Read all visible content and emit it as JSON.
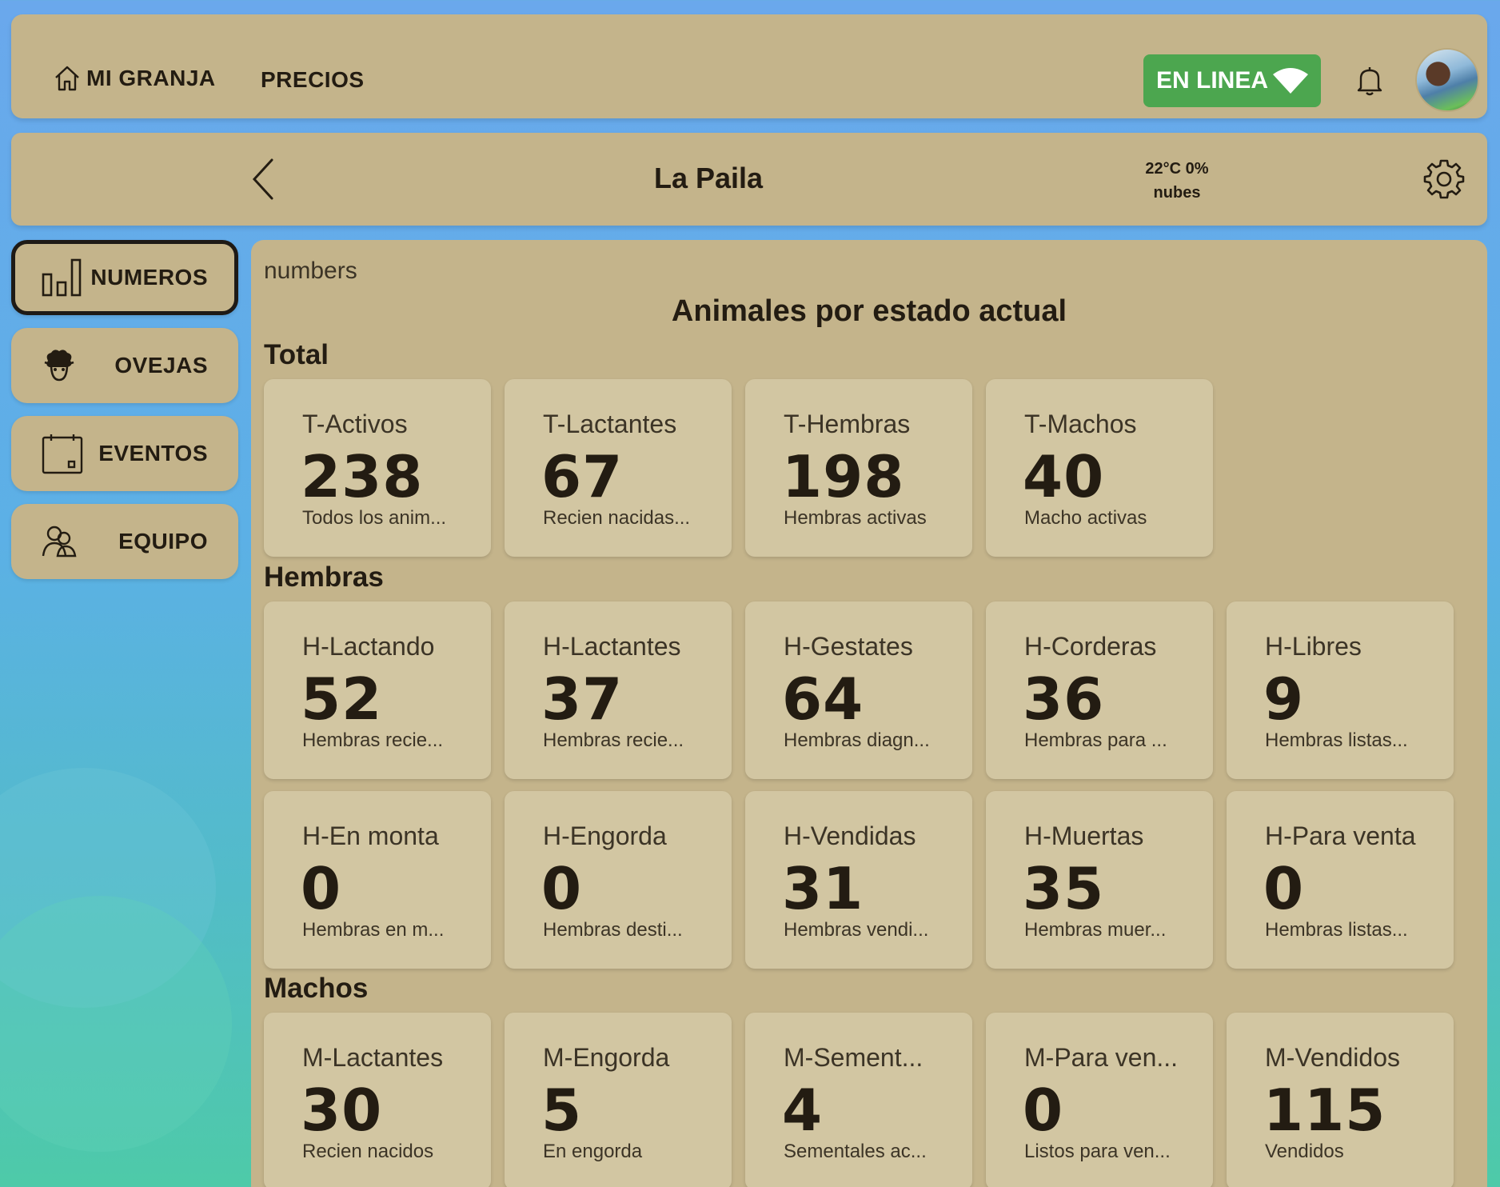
{
  "topbar": {
    "home_label": "MI GRANJA",
    "prices_label": "PRECIOS",
    "status_label": "EN LINEA",
    "status_color": "#4ca64f"
  },
  "header": {
    "farm_name": "La Paila",
    "weather_line1": "22°C 0%",
    "weather_line2": "nubes"
  },
  "sidebar": {
    "items": [
      {
        "label": "NUMEROS",
        "icon": "bar-chart-icon",
        "active": true
      },
      {
        "label": "OVEJAS",
        "icon": "sheep-icon",
        "active": false
      },
      {
        "label": "EVENTOS",
        "icon": "calendar-icon",
        "active": false
      },
      {
        "label": "EQUIPO",
        "icon": "team-icon",
        "active": false
      }
    ]
  },
  "main": {
    "breadcrumb": "numbers",
    "title": "Animales por estado actual",
    "sections": [
      {
        "title": "Total",
        "cards": [
          {
            "title": "T-Activos",
            "value": "238",
            "desc": "Todos los anim..."
          },
          {
            "title": "T-Lactantes",
            "value": "67",
            "desc": "Recien nacidas..."
          },
          {
            "title": "T-Hembras",
            "value": "198",
            "desc": "Hembras activas"
          },
          {
            "title": "T-Machos",
            "value": "40",
            "desc": "Macho activas"
          }
        ]
      },
      {
        "title": "Hembras",
        "cards": [
          {
            "title": "H-Lactando",
            "value": "52",
            "desc": "Hembras recie..."
          },
          {
            "title": "H-Lactantes",
            "value": "37",
            "desc": "Hembras recie..."
          },
          {
            "title": "H-Gestates",
            "value": "64",
            "desc": "Hembras diagn..."
          },
          {
            "title": "H-Corderas",
            "value": "36",
            "desc": "Hembras para ..."
          },
          {
            "title": "H-Libres",
            "value": "9",
            "desc": "Hembras listas..."
          },
          {
            "title": "H-En monta",
            "value": "0",
            "desc": "Hembras en m..."
          },
          {
            "title": "H-Engorda",
            "value": "0",
            "desc": "Hembras desti..."
          },
          {
            "title": "H-Vendidas",
            "value": "31",
            "desc": "Hembras vendi..."
          },
          {
            "title": "H-Muertas",
            "value": "35",
            "desc": "Hembras muer..."
          },
          {
            "title": "H-Para venta",
            "value": "0",
            "desc": "Hembras listas..."
          }
        ]
      },
      {
        "title": "Machos",
        "cards": [
          {
            "title": "M-Lactantes",
            "value": "30",
            "desc": "Recien nacidos"
          },
          {
            "title": "M-Engorda",
            "value": "5",
            "desc": "En engorda"
          },
          {
            "title": "M-Sement...",
            "value": "4",
            "desc": "Sementales ac..."
          },
          {
            "title": "M-Para ven...",
            "value": "0",
            "desc": "Listos para ven..."
          },
          {
            "title": "M-Vendidos",
            "value": "115",
            "desc": "Vendidos"
          }
        ]
      }
    ]
  }
}
